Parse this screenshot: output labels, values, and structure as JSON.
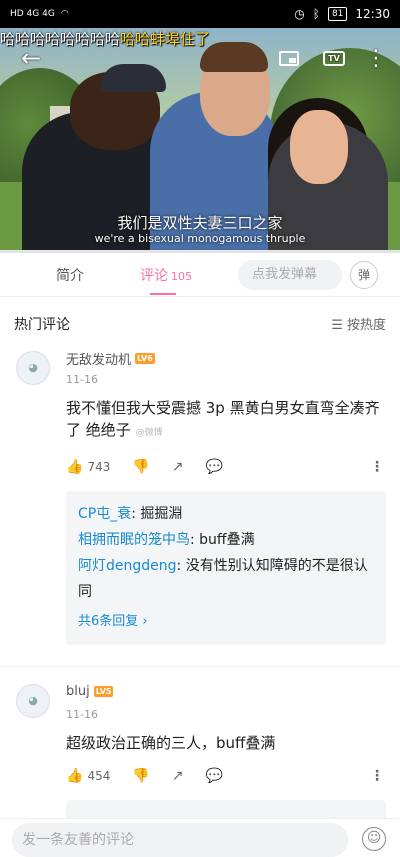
{
  "status_bar": {
    "left_icons": "HD 4G 4G",
    "battery": "81",
    "time": "12:30"
  },
  "video": {
    "danmaku_plain": "哈哈哈哈哈哈哈哈",
    "danmaku_highlight": "哈哈蚌埠住了",
    "subtitle_cn": "我们是双性夫妻三口之家",
    "subtitle_en": "we're a bisexual monogamous thruple",
    "progress_percent": 0
  },
  "tabs": {
    "intro": "简介",
    "comments": "评论",
    "comments_count": "105",
    "danmu_placeholder": "点我发弹幕",
    "danmu_btn": "弹"
  },
  "comments_header": {
    "title": "热门评论",
    "sort": "按热度"
  },
  "comments": [
    {
      "username": "无敌发动机",
      "level": "LV6",
      "date": "11-16",
      "text": "我不懂但我大受震撼 3p 黑黄白男女直弯全凑齐了 绝绝子",
      "watermark": "@微博",
      "likes": "743",
      "replies": [
        {
          "name": "CP屯_衰",
          "text": ": 掘掘淵"
        },
        {
          "name": "相拥而眠的笼中鸟",
          "text": ": buff叠满"
        },
        {
          "name": "阿灯dengdeng",
          "text": ": 没有性别认知障碍的不是很认同"
        }
      ],
      "more_replies": "共6条回复 ›"
    },
    {
      "username": "bluj",
      "level": "LV5",
      "date": "11-16",
      "text": "超级政治正确的三人，buff叠满",
      "likes": "454"
    }
  ],
  "bottom_bar": {
    "placeholder": "发一条友善的评论"
  }
}
